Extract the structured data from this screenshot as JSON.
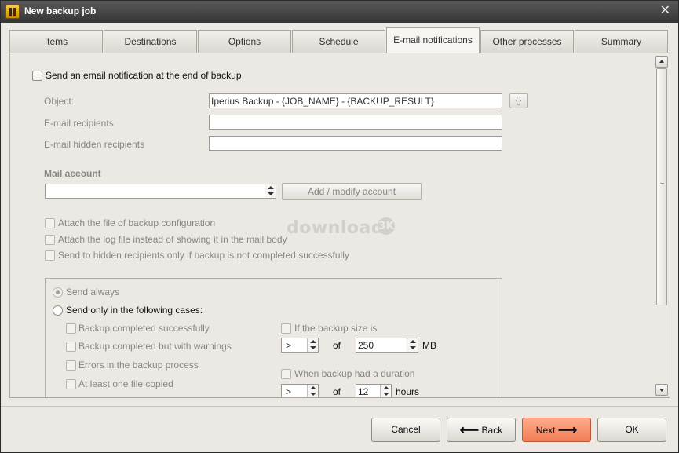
{
  "window": {
    "title": "New backup job",
    "close_label": "✕"
  },
  "tabs": [
    {
      "label": "Items"
    },
    {
      "label": "Destinations"
    },
    {
      "label": "Options"
    },
    {
      "label": "Schedule"
    },
    {
      "label": "E-mail notifications"
    },
    {
      "label": "Other processes"
    },
    {
      "label": "Summary"
    }
  ],
  "active_tab_index": 4,
  "email": {
    "send_notification_label": "Send an email notification at the end of backup",
    "object_label": "Object:",
    "object_value": "Iperius Backup - {JOB_NAME} - {BACKUP_RESULT}",
    "variables_button_label": "{}",
    "recipients_label": "E-mail recipients",
    "recipients_value": "",
    "hidden_recipients_label": "E-mail hidden recipients",
    "hidden_recipients_value": "",
    "mail_account_label": "Mail account",
    "mail_account_value": "",
    "add_modify_account_label": "Add / modify account",
    "attach_config_label": "Attach the file of backup configuration",
    "attach_log_label": "Attach the log file instead of showing it in the mail body",
    "send_hidden_only_label": "Send to hidden recipients only if backup is not completed successfully"
  },
  "conditions": {
    "send_always_label": "Send always",
    "send_only_label": "Send only in the following cases:",
    "completed_success_label": "Backup completed successfully",
    "completed_warnings_label": "Backup completed but with warnings",
    "errors_label": "Errors in the backup process",
    "at_least_one_label": "At least one file copied",
    "size_label": "If the backup size is",
    "size_operator": ">",
    "of_label": "of",
    "size_value": "250",
    "size_unit": "MB",
    "duration_label": "When backup had a duration",
    "duration_operator": ">",
    "duration_of_label": "of",
    "duration_value": "12",
    "duration_unit": "hours"
  },
  "watermark": {
    "text": "download",
    "badge": "3K"
  },
  "footer": {
    "cancel_label": "Cancel",
    "back_label": "Back",
    "next_label": "Next",
    "ok_label": "OK"
  },
  "colors": {
    "next_button": "#f07d55",
    "titlebar": "#404040",
    "panel": "#ece9e4"
  }
}
